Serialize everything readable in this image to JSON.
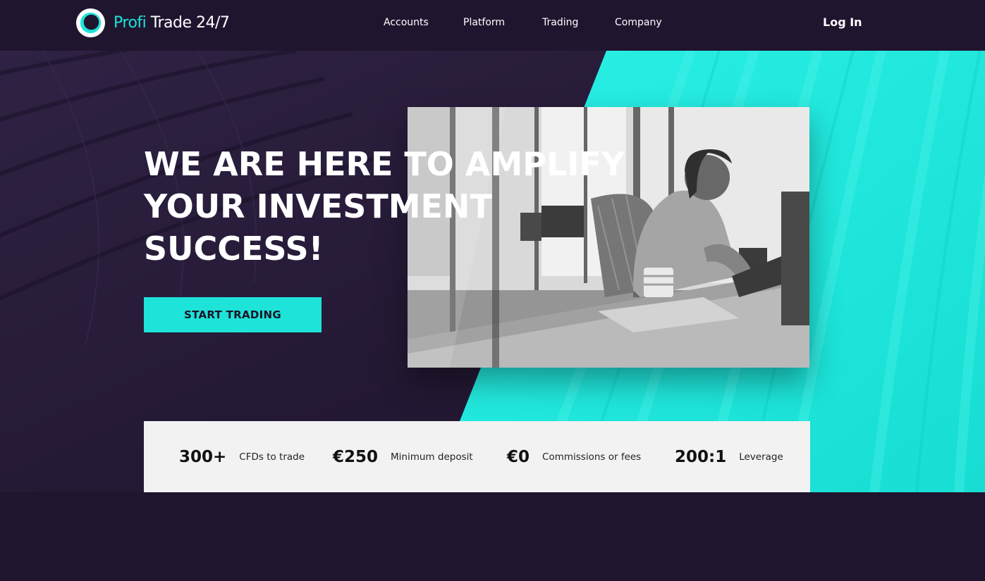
{
  "brand": {
    "name_part1": "Profi",
    "name_part2": " Trade 24/7"
  },
  "nav": {
    "items": [
      "Accounts",
      "Platform",
      "Trading",
      "Company"
    ],
    "login": "Log In"
  },
  "hero": {
    "headline_lines": [
      "WE ARE HERE TO AMPLIFY",
      "YOUR INVESTMENT",
      "SUCCESS!"
    ],
    "cta_label": "START TRADING"
  },
  "stats": [
    {
      "value": "300+",
      "label": "CFDs to trade"
    },
    {
      "value": "€250",
      "label": "Minimum deposit"
    },
    {
      "value": "€0",
      "label": "Commissions or fees"
    },
    {
      "value": "200:1",
      "label": "Leverage"
    }
  ],
  "colors": {
    "background": "#1f152e",
    "accent": "#1ee3d8",
    "stats_bg": "#f2f2f2"
  }
}
